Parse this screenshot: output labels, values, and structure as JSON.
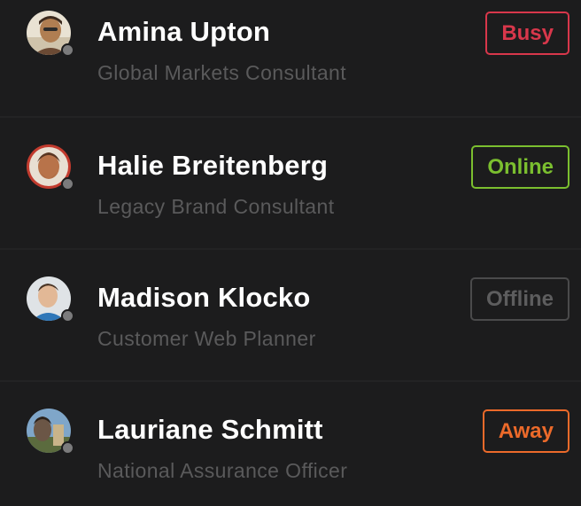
{
  "contacts": [
    {
      "name": "Amina Upton",
      "title": "Global Markets Consultant",
      "status": "Busy",
      "status_color": "#d8374b",
      "presence_dot_color": "#7b7b7c"
    },
    {
      "name": "Halie Breitenberg",
      "title": "Legacy Brand Consultant",
      "status": "Online",
      "status_color": "#7bbf2f",
      "presence_dot_color": "#7b7b7c"
    },
    {
      "name": "Madison Klocko",
      "title": "Customer Web Planner",
      "status": "Offline",
      "status_color": "#5d5d5e",
      "presence_dot_color": "#7b7b7c"
    },
    {
      "name": "Lauriane Schmitt",
      "title": "National Assurance Officer",
      "status": "Away",
      "status_color": "#ec6a2a",
      "presence_dot_color": "#7b7b7c"
    }
  ]
}
